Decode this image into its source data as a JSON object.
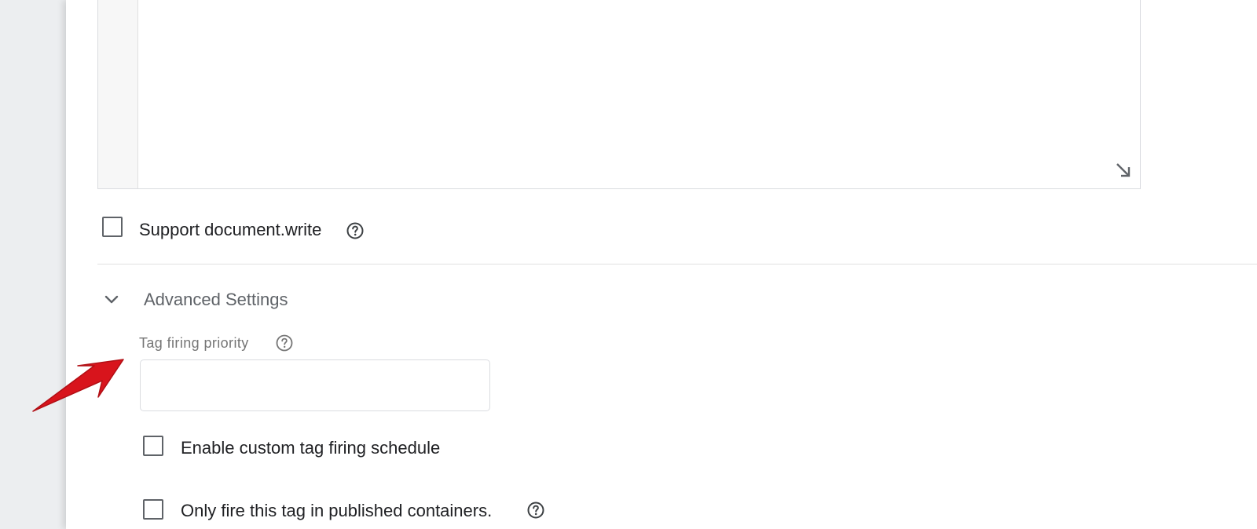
{
  "colors": {
    "arrow": "#d8141c",
    "section_title": "#5f6368",
    "field_label": "#757575",
    "border": "#dadce0"
  },
  "support_document_write": {
    "label": "Support document.write",
    "checked": false,
    "help_icon": "help-circle-icon"
  },
  "advanced_settings": {
    "title": "Advanced Settings",
    "expanded": true,
    "tag_firing_priority": {
      "label": "Tag firing priority",
      "value": "",
      "help_icon": "help-circle-icon"
    },
    "custom_schedule": {
      "label": "Enable custom tag firing schedule",
      "checked": false
    },
    "published_only": {
      "label": "Only fire this tag in published containers.",
      "checked": false,
      "help_icon": "help-circle-icon"
    }
  }
}
